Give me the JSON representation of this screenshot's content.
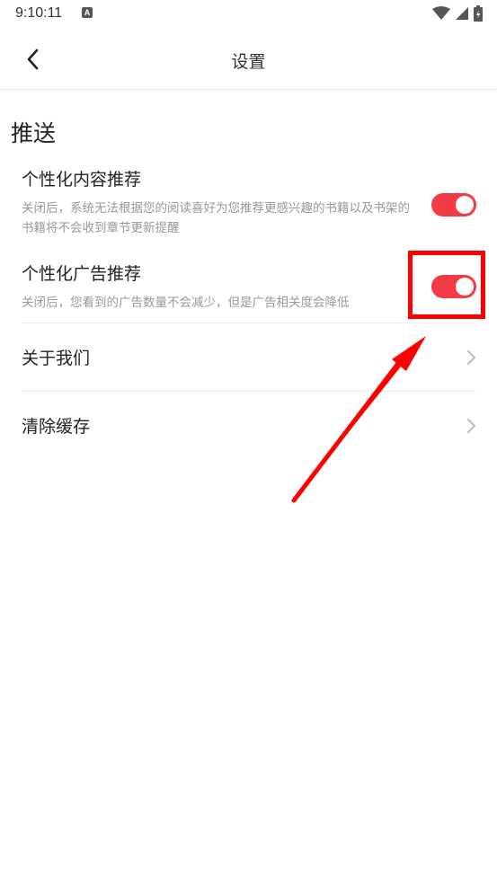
{
  "status_bar": {
    "time": "9:10:11",
    "app_icon_glyph": "A",
    "icons": [
      "wifi-icon",
      "signal-icon",
      "battery-icon"
    ]
  },
  "nav": {
    "title": "设置",
    "back_icon": "chevron-left-icon"
  },
  "section": {
    "title": "推送"
  },
  "settings": [
    {
      "title": "个性化内容推荐",
      "desc": "关闭后，系统无法根据您的阅读喜好为您推荐更感兴趣的书籍以及书架的书籍将不会收到章节更新提醒",
      "enabled": true
    },
    {
      "title": "个性化广告推荐",
      "desc": "关闭后，您看到的广告数量不会减少，但是广告相关度会降低",
      "enabled": true
    }
  ],
  "links": [
    {
      "label": "关于我们",
      "icon": "chevron-right-icon"
    },
    {
      "label": "清除缓存",
      "icon": "chevron-right-icon"
    }
  ],
  "colors": {
    "toggle_on": "#f23b45",
    "annotation": "#ff0000",
    "desc_text": "#999999"
  }
}
